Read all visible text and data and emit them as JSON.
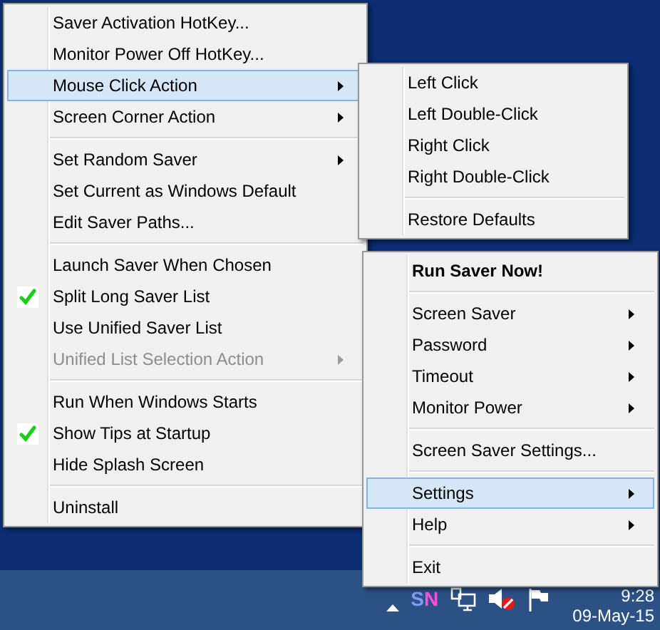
{
  "settings_menu": {
    "items": [
      {
        "kind": "item",
        "label": "Saver Activation HotKey...",
        "submenu": false,
        "selected": false,
        "checked": false,
        "disabled": false
      },
      {
        "kind": "item",
        "label": "Monitor Power Off HotKey...",
        "submenu": false,
        "selected": false,
        "checked": false,
        "disabled": false
      },
      {
        "kind": "item",
        "label": "Mouse Click Action",
        "submenu": true,
        "selected": true,
        "checked": false,
        "disabled": false
      },
      {
        "kind": "item",
        "label": "Screen Corner Action",
        "submenu": true,
        "selected": false,
        "checked": false,
        "disabled": false
      },
      {
        "kind": "separator"
      },
      {
        "kind": "item",
        "label": "Set Random Saver",
        "submenu": true,
        "selected": false,
        "checked": false,
        "disabled": false
      },
      {
        "kind": "item",
        "label": "Set Current as Windows Default",
        "submenu": false,
        "selected": false,
        "checked": false,
        "disabled": false
      },
      {
        "kind": "item",
        "label": "Edit Saver Paths...",
        "submenu": false,
        "selected": false,
        "checked": false,
        "disabled": false
      },
      {
        "kind": "separator"
      },
      {
        "kind": "item",
        "label": "Launch Saver When Chosen",
        "submenu": false,
        "selected": false,
        "checked": false,
        "disabled": false
      },
      {
        "kind": "item",
        "label": "Split Long Saver List",
        "submenu": false,
        "selected": false,
        "checked": true,
        "disabled": false
      },
      {
        "kind": "item",
        "label": "Use Unified Saver List",
        "submenu": false,
        "selected": false,
        "checked": false,
        "disabled": false
      },
      {
        "kind": "item",
        "label": "Unified List Selection Action",
        "submenu": true,
        "selected": false,
        "checked": false,
        "disabled": true
      },
      {
        "kind": "separator"
      },
      {
        "kind": "item",
        "label": "Run When Windows Starts",
        "submenu": false,
        "selected": false,
        "checked": false,
        "disabled": false
      },
      {
        "kind": "item",
        "label": "Show Tips at Startup",
        "submenu": false,
        "selected": false,
        "checked": true,
        "disabled": false
      },
      {
        "kind": "item",
        "label": "Hide Splash Screen",
        "submenu": false,
        "selected": false,
        "checked": false,
        "disabled": false
      },
      {
        "kind": "separator"
      },
      {
        "kind": "item",
        "label": "Uninstall",
        "submenu": false,
        "selected": false,
        "checked": false,
        "disabled": false
      }
    ]
  },
  "mouse_click_menu": {
    "items": [
      {
        "kind": "item",
        "label": "Left Click",
        "submenu": false,
        "selected": false,
        "checked": false,
        "disabled": false
      },
      {
        "kind": "item",
        "label": "Left Double-Click",
        "submenu": false,
        "selected": false,
        "checked": false,
        "disabled": false
      },
      {
        "kind": "item",
        "label": "Right Click",
        "submenu": false,
        "selected": false,
        "checked": false,
        "disabled": false
      },
      {
        "kind": "item",
        "label": "Right Double-Click",
        "submenu": false,
        "selected": false,
        "checked": false,
        "disabled": false
      },
      {
        "kind": "separator"
      },
      {
        "kind": "item",
        "label": "Restore Defaults",
        "submenu": false,
        "selected": false,
        "checked": false,
        "disabled": false
      }
    ]
  },
  "tray_menu": {
    "items": [
      {
        "kind": "default_item",
        "label": "Run Saver Now!",
        "submenu": false,
        "selected": false,
        "checked": false,
        "disabled": false
      },
      {
        "kind": "separator"
      },
      {
        "kind": "item",
        "label": "Screen Saver",
        "submenu": true,
        "selected": false,
        "checked": false,
        "disabled": false
      },
      {
        "kind": "item",
        "label": "Password",
        "submenu": true,
        "selected": false,
        "checked": false,
        "disabled": false
      },
      {
        "kind": "item",
        "label": "Timeout",
        "submenu": true,
        "selected": false,
        "checked": false,
        "disabled": false
      },
      {
        "kind": "item",
        "label": "Monitor Power",
        "submenu": true,
        "selected": false,
        "checked": false,
        "disabled": false
      },
      {
        "kind": "separator"
      },
      {
        "kind": "item",
        "label": "Screen Saver Settings...",
        "submenu": false,
        "selected": false,
        "checked": false,
        "disabled": false
      },
      {
        "kind": "separator"
      },
      {
        "kind": "item",
        "label": "Settings",
        "submenu": true,
        "selected": true,
        "checked": false,
        "disabled": false
      },
      {
        "kind": "item",
        "label": "Help",
        "submenu": true,
        "selected": false,
        "checked": false,
        "disabled": false
      },
      {
        "kind": "separator"
      },
      {
        "kind": "item",
        "label": "Exit",
        "submenu": false,
        "selected": false,
        "checked": false,
        "disabled": false
      }
    ]
  },
  "taskbar": {
    "tray_logo_letters": [
      "S",
      "N"
    ],
    "clock": {
      "time": "9:28",
      "date": "09-May-15"
    }
  }
}
